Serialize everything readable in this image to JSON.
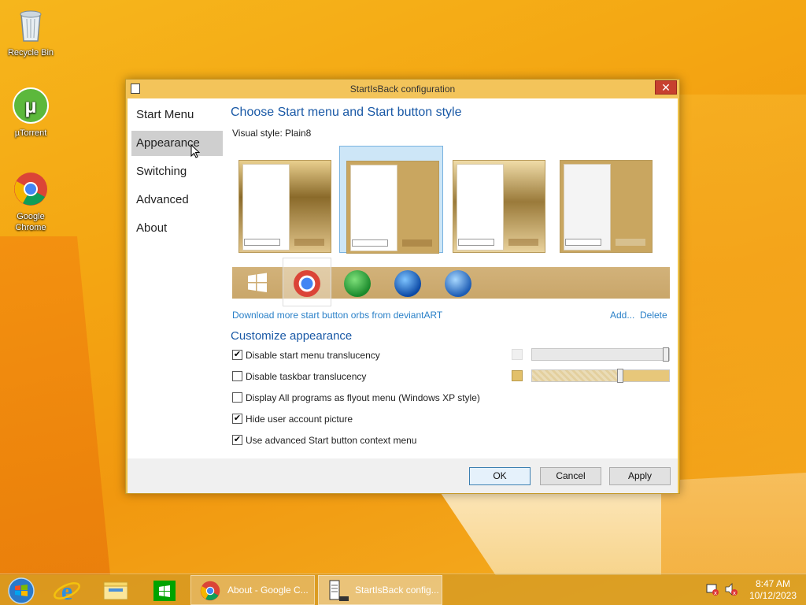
{
  "desktop": {
    "icons": [
      {
        "label": "Recycle Bin"
      },
      {
        "label": "µTorrent"
      },
      {
        "label": "Google Chrome"
      }
    ]
  },
  "window": {
    "title": "StartIsBack configuration",
    "close_glyph": "✕",
    "sidebar": {
      "items": [
        {
          "label": "Start Menu"
        },
        {
          "label": "Appearance"
        },
        {
          "label": "Switching"
        },
        {
          "label": "Advanced"
        },
        {
          "label": "About"
        }
      ]
    },
    "main": {
      "heading": "Choose Start menu and Start button style",
      "visual_style_label": "Visual style:",
      "visual_style_value": "Plain8",
      "download_link": "Download more start button orbs from deviantART",
      "add_link": "Add...",
      "delete_link": "Delete",
      "customize_heading": "Customize appearance",
      "options": [
        {
          "label": "Disable start menu translucency",
          "checked": true
        },
        {
          "label": "Disable taskbar translucency",
          "checked": false
        },
        {
          "label": "Display All programs as flyout menu (Windows XP style)",
          "checked": false
        },
        {
          "label": "Hide user account picture",
          "checked": true
        },
        {
          "label": "Use advanced Start button context menu",
          "checked": true
        }
      ],
      "menu_opacity": 1.0,
      "taskbar_opacity": 0.65
    },
    "footer": {
      "ok_label": "OK",
      "cancel_label": "Cancel",
      "apply_label": "Apply"
    }
  },
  "taskbar": {
    "tasks": [
      {
        "label": "About - Google C..."
      },
      {
        "label": "StartIsBack config..."
      }
    ],
    "clock_time": "8:47 AM",
    "clock_date": "10/12/2023"
  },
  "colors": {
    "accent": "#1a59a6",
    "link": "#2a80c8",
    "close": "#c7402f"
  }
}
